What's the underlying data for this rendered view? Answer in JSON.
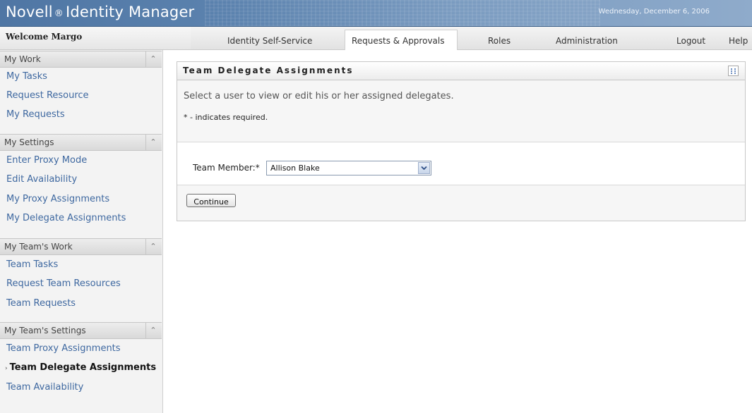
{
  "header": {
    "app_name": "Novell",
    "registered_mark": "®",
    "app_product": "Identity Manager",
    "date": "Wednesday, December 6, 2006"
  },
  "navbar": {
    "welcome": "Welcome Margo",
    "tabs": [
      {
        "label": "Identity Self-Service",
        "active": false
      },
      {
        "label": "Requests & Approvals",
        "active": true
      },
      {
        "label": "Roles",
        "active": false
      },
      {
        "label": "Administration",
        "active": false
      },
      {
        "label": "Logout",
        "active": false
      },
      {
        "label": "Help",
        "active": false
      }
    ]
  },
  "sidebar": {
    "sections": [
      {
        "title": "My Work",
        "items": [
          "My Tasks",
          "Request Resource",
          "My Requests"
        ]
      },
      {
        "title": "My Settings",
        "items": [
          "Enter Proxy Mode",
          "Edit Availability",
          "My Proxy Assignments",
          "My Delegate Assignments"
        ]
      },
      {
        "title": "My Team's Work",
        "items": [
          "Team Tasks",
          "Request Team Resources",
          "Team Requests"
        ]
      },
      {
        "title": "My Team's Settings",
        "items": [
          "Team Proxy Assignments",
          "Team Delegate Assignments",
          "Team Availability"
        ]
      }
    ],
    "active_item": "Team Delegate Assignments",
    "collapse_icon": "double-chevron-up-icon"
  },
  "panel": {
    "title": "Team Delegate Assignments",
    "instructions": "Select a user to view or edit his or her assigned delegates.",
    "required_note": "* - indicates required.",
    "team_member_label": "Team Member:*",
    "team_member_value": "Allison Blake",
    "continue_label": "Continue",
    "menu_icon": "panel-menu-icon"
  },
  "colors": {
    "header_blue": "#5b82ae",
    "link_blue": "#3e68a0"
  }
}
